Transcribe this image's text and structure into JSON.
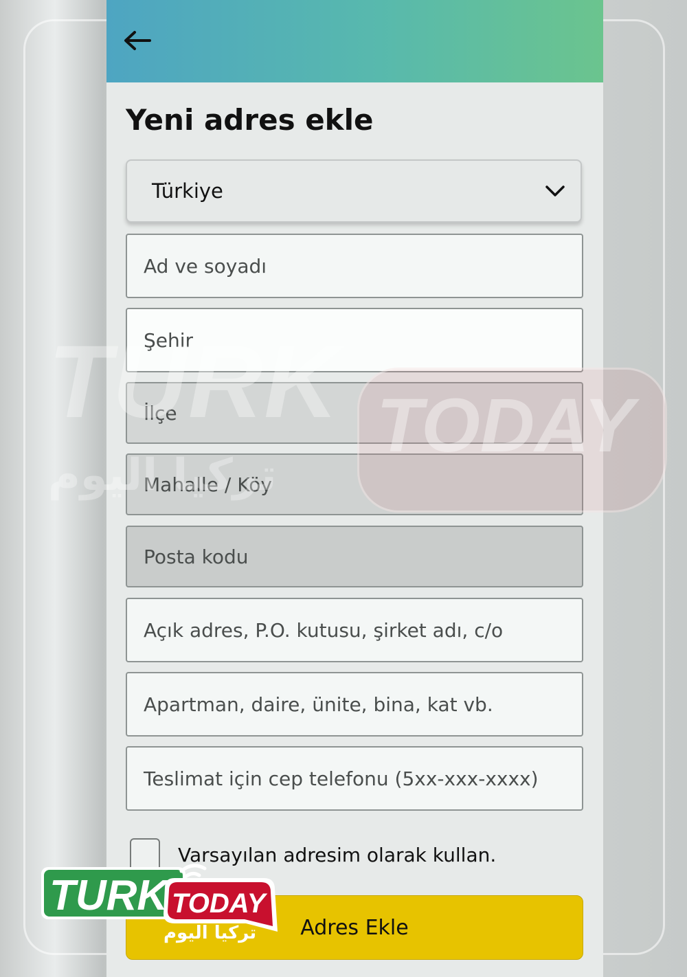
{
  "header": {
    "back_icon": "arrow-left-icon"
  },
  "page": {
    "title": "Yeni adres ekle"
  },
  "country_select": {
    "value": "Türkiye",
    "icon": "chevron-down-icon"
  },
  "fields": {
    "full_name": "Ad ve soyadı",
    "city": "Şehir",
    "district": "İlçe",
    "neighborhood": "Mahalle / Köy",
    "postal_code": "Posta kodu",
    "address_line1": "Açık adres, P.O. kutusu, şirket adı, c/o",
    "address_line2": "Apartman, daire, ünite, bina, kat vb.",
    "phone": "Teslimat için cep telefonu (5xx-xxx-xxxx)"
  },
  "default_address": {
    "label": "Varsayılan adresim olarak kullan.",
    "checked": false
  },
  "submit": {
    "label": "Adres Ekle",
    "color": "#e7c300"
  },
  "watermark": {
    "latin_1": "TURK",
    "latin_2": "TODAY",
    "arabic": "تركيا اليوم"
  },
  "logo": {
    "latin_1": "TURK",
    "latin_2": "TODAY",
    "arabic": "تركيا اليوم"
  },
  "colors": {
    "header_start": "#4ea5c2",
    "header_end": "#6bc48e",
    "logo_green": "#2f9a4c",
    "logo_red": "#c8102e"
  }
}
